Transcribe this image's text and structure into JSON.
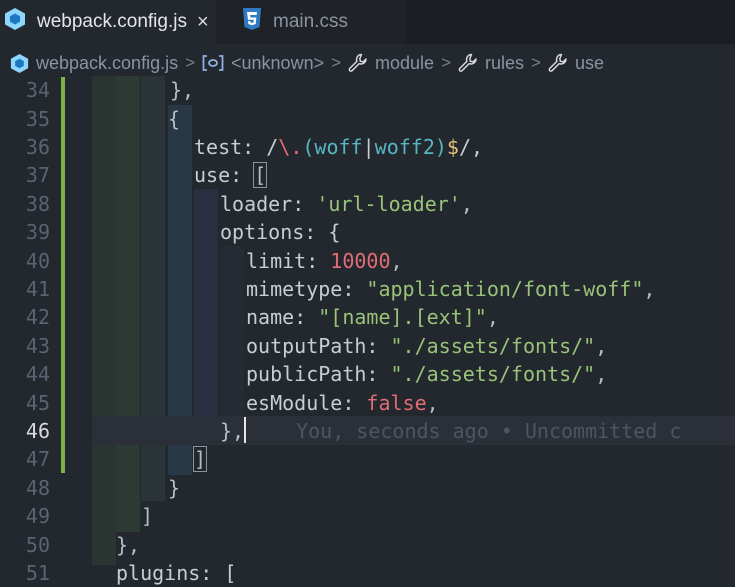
{
  "tabs": [
    {
      "label": "webpack.config.js",
      "icon": "webpack-icon",
      "active": true,
      "close": "×"
    },
    {
      "label": "main.css",
      "icon": "css3-icon",
      "active": false
    }
  ],
  "breadcrumb": [
    {
      "label": "webpack.config.js",
      "icon": "webpack-icon"
    },
    {
      "label": "<unknown>",
      "icon": "symbol-namespace-icon"
    },
    {
      "label": "module",
      "icon": "wrench-icon"
    },
    {
      "label": "rules",
      "icon": "wrench-icon"
    },
    {
      "label": "use",
      "icon": "wrench-icon"
    }
  ],
  "colors": {
    "background": "#23272e",
    "tab_bar": "#1b1e23",
    "modified_gutter": "#7fb04a",
    "string": "#98c379",
    "number": "#e06c75",
    "regex_special": "#56b6c2"
  },
  "editor": {
    "current_line": "46",
    "blame": "You, seconds ago • Uncommitted c",
    "lines": [
      {
        "n": "34",
        "tokens": [
          {
            "t": "},",
            "c": "punc"
          }
        ]
      },
      {
        "n": "35",
        "tokens": [
          {
            "t": "{",
            "c": "punc"
          }
        ]
      },
      {
        "n": "36",
        "tokens": [
          {
            "t": "test: ",
            "c": "key"
          },
          {
            "t": "/",
            "c": "rx"
          },
          {
            "t": "\\.",
            "c": "rxesc"
          },
          {
            "t": "(woff",
            "c": "rxs"
          },
          {
            "t": "|",
            "c": "rx"
          },
          {
            "t": "woff2)",
            "c": "rxs"
          },
          {
            "t": "$",
            "c": "rxe"
          },
          {
            "t": "/,",
            "c": "rx"
          }
        ]
      },
      {
        "n": "37",
        "tokens": [
          {
            "t": "use: ",
            "c": "key"
          },
          {
            "t": "[",
            "c": "box"
          }
        ]
      },
      {
        "n": "38",
        "tokens": [
          {
            "t": "loader: ",
            "c": "key"
          },
          {
            "t": "'url-loader'",
            "c": "str"
          },
          {
            "t": ",",
            "c": "punc"
          }
        ]
      },
      {
        "n": "39",
        "tokens": [
          {
            "t": "options: {",
            "c": "key"
          }
        ]
      },
      {
        "n": "40",
        "tokens": [
          {
            "t": "limit: ",
            "c": "key"
          },
          {
            "t": "10000",
            "c": "num"
          },
          {
            "t": ",",
            "c": "punc"
          }
        ]
      },
      {
        "n": "41",
        "tokens": [
          {
            "t": "mimetype: ",
            "c": "key"
          },
          {
            "t": "\"application/font-woff\"",
            "c": "str"
          },
          {
            "t": ",",
            "c": "punc"
          }
        ]
      },
      {
        "n": "42",
        "tokens": [
          {
            "t": "name: ",
            "c": "key"
          },
          {
            "t": "\"[name].[ext]\"",
            "c": "str"
          },
          {
            "t": ",",
            "c": "punc"
          }
        ]
      },
      {
        "n": "43",
        "tokens": [
          {
            "t": "outputPath: ",
            "c": "key"
          },
          {
            "t": "\"./assets/fonts/\"",
            "c": "str"
          },
          {
            "t": ",",
            "c": "punc"
          }
        ]
      },
      {
        "n": "44",
        "tokens": [
          {
            "t": "publicPath: ",
            "c": "key"
          },
          {
            "t": "\"./assets/fonts/\"",
            "c": "str"
          },
          {
            "t": ",",
            "c": "punc"
          }
        ]
      },
      {
        "n": "45",
        "tokens": [
          {
            "t": "esModule: ",
            "c": "key"
          },
          {
            "t": "false",
            "c": "bool"
          },
          {
            "t": ",",
            "c": "punc"
          }
        ]
      },
      {
        "n": "46",
        "tokens": [
          {
            "t": "},",
            "c": "punc"
          }
        ]
      },
      {
        "n": "47",
        "tokens": [
          {
            "t": "]",
            "c": "box"
          }
        ]
      },
      {
        "n": "48",
        "tokens": [
          {
            "t": "}",
            "c": "punc"
          }
        ]
      },
      {
        "n": "49",
        "tokens": [
          {
            "t": "]",
            "c": "punc"
          }
        ]
      },
      {
        "n": "50",
        "tokens": [
          {
            "t": "},",
            "c": "punc"
          }
        ]
      },
      {
        "n": "51",
        "tokens": [
          {
            "t": "plugins: [",
            "c": "key"
          }
        ]
      }
    ]
  }
}
